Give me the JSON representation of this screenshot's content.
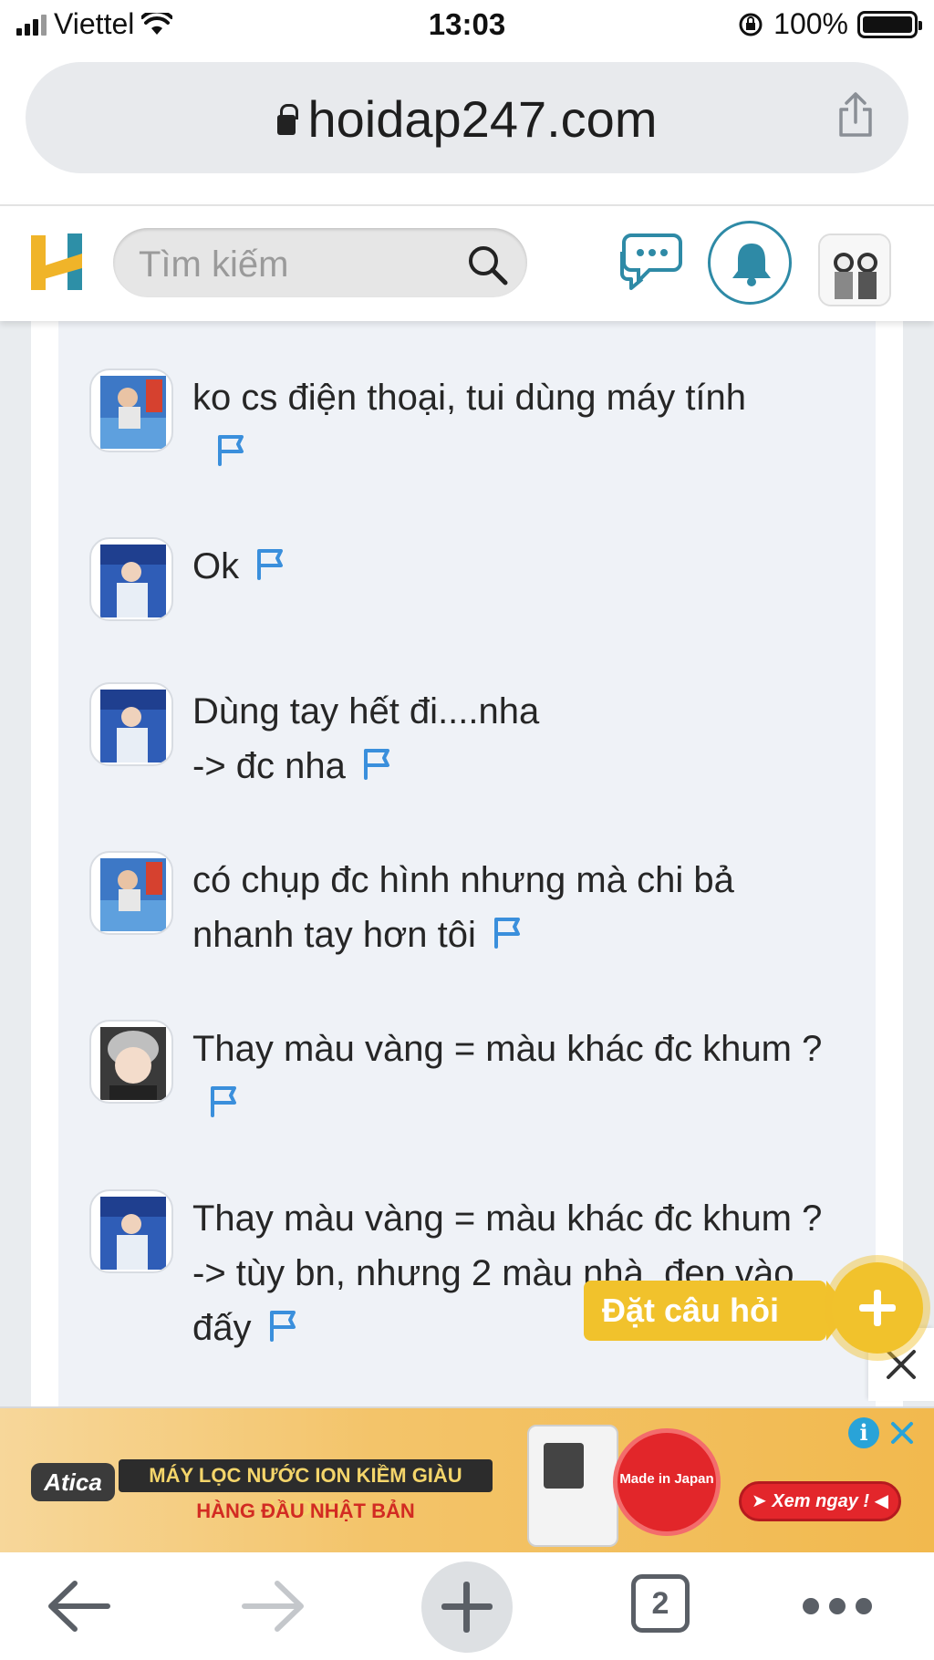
{
  "status_bar": {
    "carrier": "Viettel",
    "time": "13:03",
    "battery": "100%"
  },
  "browser": {
    "url": "hoidap247.com",
    "open_tabs": "2",
    "icons": [
      "lock-icon",
      "share-icon",
      "back-icon",
      "forward-icon",
      "new-tab-icon",
      "more-icon"
    ]
  },
  "site_header": {
    "logo": "H",
    "search_placeholder": "Tìm kiếm",
    "icons": [
      "search-icon",
      "chat-icon",
      "bell-icon"
    ]
  },
  "comments": [
    {
      "text": "ko cs điện thoại, tui dùng máy tính",
      "avatar": "user-a"
    },
    {
      "text": "Ok",
      "avatar": "user-b"
    },
    {
      "text": "Dùng tay hết đi....nha\n-> đc nha",
      "avatar": "user-b"
    },
    {
      "text": "có chụp đc hình nhưng mà chi bả nhanh tay hơn tôi",
      "avatar": "user-a"
    },
    {
      "text": "Thay màu vàng = màu khác đc khum ?",
      "avatar": "user-c"
    },
    {
      "text": "Thay màu vàng = màu khác đc khum ?\n-> tùy bn, nhưng 2 màu nhà, đẹp vào đấy",
      "avatar": "user-b"
    }
  ],
  "ask_button": {
    "label": "Đặt câu hỏi"
  },
  "ad": {
    "brand": "Atica",
    "headline": "MÁY LỌC NƯỚC ION KIỀM GIÀU HYDRO",
    "subline": "HÀNG ĐẦU NHẬT BẢN",
    "seal": "Made in Japan",
    "cta": "➤ Xem ngay ! ◀",
    "info": "i"
  },
  "colors": {
    "accent_yellow": "#f1c22c",
    "accent_teal": "#2e8aa6",
    "flag_blue": "#3a8fdc",
    "thread_bg": "#eff2f7"
  }
}
